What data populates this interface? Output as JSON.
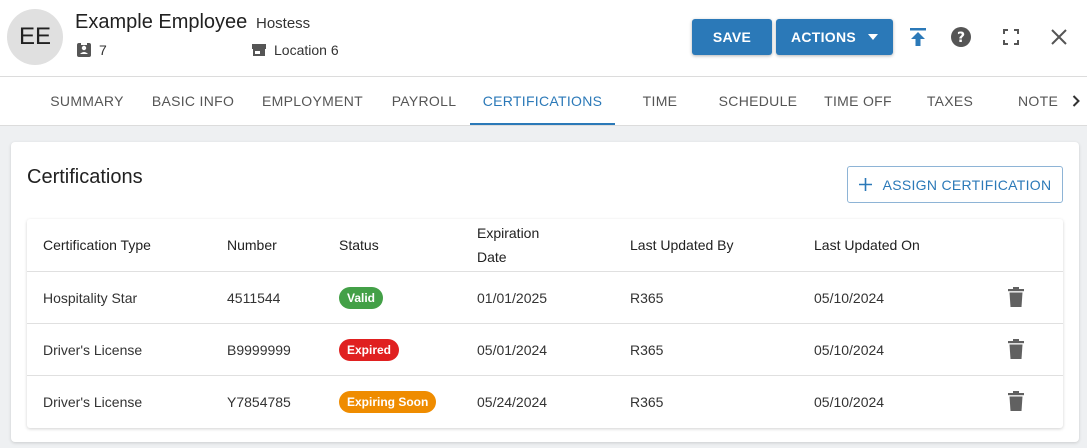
{
  "header": {
    "avatar_initials": "EE",
    "employee_name": "Example Employee",
    "employee_role": "Hostess",
    "employee_id": "7",
    "location": "Location 6",
    "save_label": "SAVE",
    "actions_label": "ACTIONS",
    "icons": [
      "upload-icon",
      "help-icon",
      "fullscreen-icon",
      "close-icon"
    ]
  },
  "tabs": [
    {
      "label": "SUMMARY"
    },
    {
      "label": "BASIC INFO"
    },
    {
      "label": "EMPLOYMENT"
    },
    {
      "label": "PAYROLL"
    },
    {
      "label": "CERTIFICATIONS",
      "active": true
    },
    {
      "label": "TIME"
    },
    {
      "label": "SCHEDULE"
    },
    {
      "label": "TIME OFF"
    },
    {
      "label": "TAXES"
    },
    {
      "label": "NOTE"
    }
  ],
  "certifications": {
    "title": "Certifications",
    "assign_label": "ASSIGN CERTIFICATION",
    "columns": {
      "type": "Certification Type",
      "number": "Number",
      "status": "Status",
      "expiration_line1": "Expiration",
      "expiration_line2": "Date",
      "updated_by": "Last Updated By",
      "updated_on": "Last Updated On"
    },
    "rows": [
      {
        "type": "Hospitality Star",
        "number": "4511544",
        "status": "Valid",
        "status_color": "#43a047",
        "expiration": "01/01/2025",
        "updated_by": "R365",
        "updated_on": "05/10/2024"
      },
      {
        "type": "Driver's License",
        "number": "B9999999",
        "status": "Expired",
        "status_color": "#e02020",
        "expiration": "05/01/2024",
        "updated_by": "R365",
        "updated_on": "05/10/2024"
      },
      {
        "type": "Driver's License",
        "number": "Y7854785",
        "status": "Expiring Soon",
        "status_color": "#ef8c00",
        "expiration": "05/24/2024",
        "updated_by": "R365",
        "updated_on": "05/10/2024"
      }
    ]
  },
  "colors": {
    "accent": "#2b79b8"
  }
}
